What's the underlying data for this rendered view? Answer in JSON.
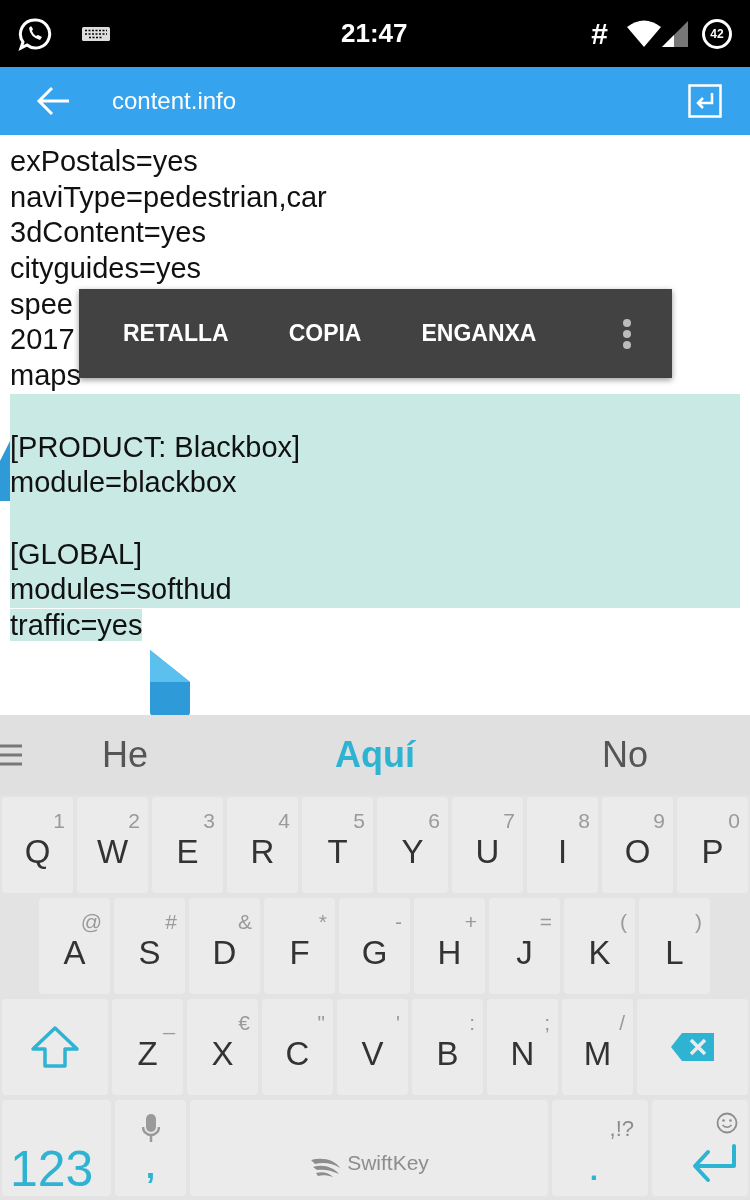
{
  "status_bar": {
    "time": "21:47",
    "hash": "#",
    "battery": "42"
  },
  "app_bar": {
    "title": "content.info"
  },
  "editor": {
    "lines": [
      {
        "kind": "text",
        "text": "exPostals=yes",
        "selected": false
      },
      {
        "kind": "text",
        "text": "naviType=pedestrian,car",
        "selected": false
      },
      {
        "kind": "text",
        "text": "3dContent=yes",
        "selected": false
      },
      {
        "kind": "text",
        "text": "cityguides=yes",
        "selected": false
      },
      {
        "kind": "text",
        "text": "spee",
        "selected": false
      },
      {
        "kind": "text",
        "text": "2017",
        "selected": false
      },
      {
        "kind": "text",
        "text": "maps",
        "selected": false
      },
      {
        "kind": "blank",
        "selected": true
      },
      {
        "kind": "text",
        "text": "[PRODUCT: Blackbox]",
        "selected": true
      },
      {
        "kind": "text",
        "text": "module=blackbox",
        "selected": true
      },
      {
        "kind": "blank",
        "selected": true
      },
      {
        "kind": "text",
        "text": "[GLOBAL]",
        "selected": true
      },
      {
        "kind": "text",
        "text": "modules=softhud",
        "selected": true
      },
      {
        "kind": "text",
        "text": "traffic=yes",
        "selected": true
      }
    ]
  },
  "context_menu": {
    "items": [
      "RETALLA",
      "COPIA",
      "ENGANXA"
    ]
  },
  "suggestions": [
    {
      "text": "He",
      "selected": false
    },
    {
      "text": "Aquí",
      "selected": true
    },
    {
      "text": "No",
      "selected": false
    }
  ],
  "keyboard": {
    "rows": [
      {
        "keys": [
          {
            "kind": "letter",
            "label": "Q",
            "hint": "1"
          },
          {
            "kind": "letter",
            "label": "W",
            "hint": "2"
          },
          {
            "kind": "letter",
            "label": "E",
            "hint": "3"
          },
          {
            "kind": "letter",
            "label": "R",
            "hint": "4"
          },
          {
            "kind": "letter",
            "label": "T",
            "hint": "5"
          },
          {
            "kind": "letter",
            "label": "Y",
            "hint": "6"
          },
          {
            "kind": "letter",
            "label": "U",
            "hint": "7"
          },
          {
            "kind": "letter",
            "label": "I",
            "hint": "8"
          },
          {
            "kind": "letter",
            "label": "O",
            "hint": "9"
          },
          {
            "kind": "letter",
            "label": "P",
            "hint": "0"
          }
        ]
      },
      {
        "keys": [
          {
            "kind": "letter",
            "label": "A",
            "hint": "@"
          },
          {
            "kind": "letter",
            "label": "S",
            "hint": "#"
          },
          {
            "kind": "letter",
            "label": "D",
            "hint": "&"
          },
          {
            "kind": "letter",
            "label": "F",
            "hint": "*"
          },
          {
            "kind": "letter",
            "label": "G",
            "hint": "-"
          },
          {
            "kind": "letter",
            "label": "H",
            "hint": "+"
          },
          {
            "kind": "letter",
            "label": "J",
            "hint": "="
          },
          {
            "kind": "letter",
            "label": "K",
            "hint": "("
          },
          {
            "kind": "letter",
            "label": "L",
            "hint": ")"
          }
        ]
      },
      {
        "keys": [
          {
            "kind": "shift"
          },
          {
            "kind": "letter",
            "label": "Z",
            "hint": "_"
          },
          {
            "kind": "letter",
            "label": "X",
            "hint": "€"
          },
          {
            "kind": "letter",
            "label": "C",
            "hint": "\""
          },
          {
            "kind": "letter",
            "label": "V",
            "hint": "'"
          },
          {
            "kind": "letter",
            "label": "B",
            "hint": ":"
          },
          {
            "kind": "letter",
            "label": "N",
            "hint": ";"
          },
          {
            "kind": "letter",
            "label": "M",
            "hint": "/"
          },
          {
            "kind": "backspace"
          }
        ]
      }
    ],
    "bottom_row": {
      "mode_key": "123",
      "comma_key": ",",
      "space_key": "SwiftKey",
      "period_key": ".",
      "punctuation_hint": ",!?"
    }
  }
}
